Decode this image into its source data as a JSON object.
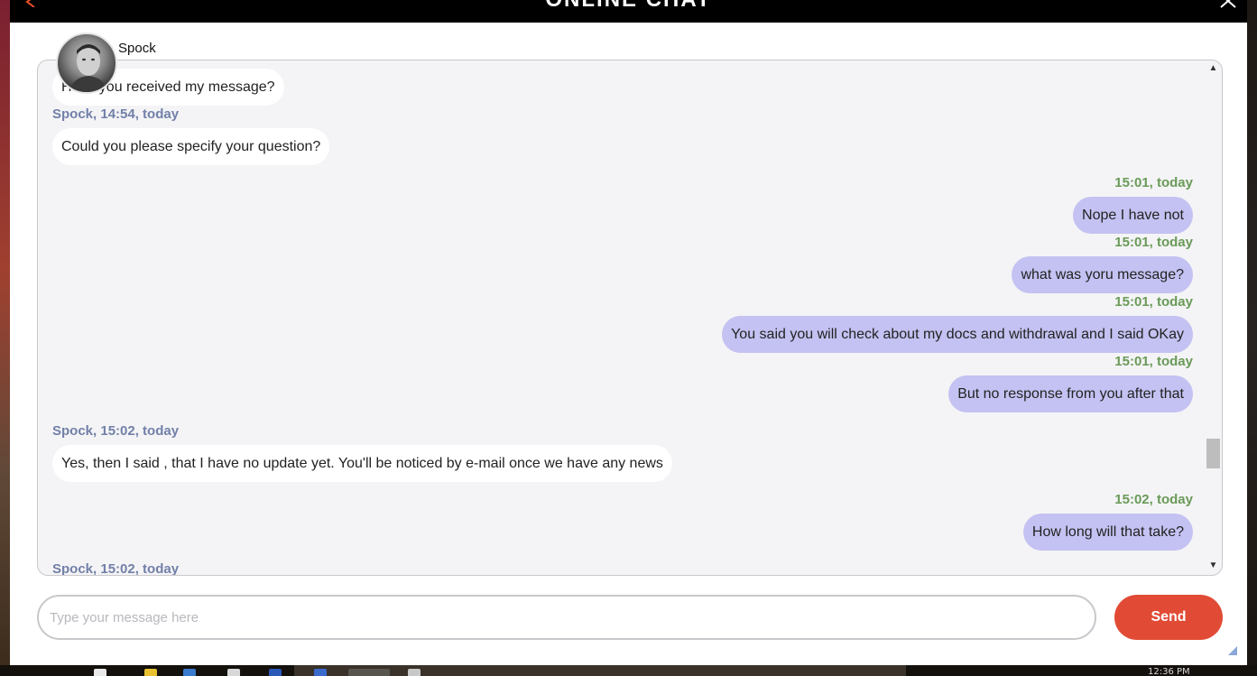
{
  "modal": {
    "title": "ONLINE CHAT",
    "back_icon": "back-triangle-icon",
    "close_icon": "close-icon"
  },
  "agent": {
    "name": "Spock",
    "avatar_icon": "agent-avatar"
  },
  "messages": [
    {
      "from": "agent",
      "text": "Have you received my message?"
    },
    {
      "from": "agent",
      "meta": "Spock, 14:54, today",
      "text": "Could you please specify your question?"
    },
    {
      "from": "user",
      "meta": "15:01, today",
      "text": "Nope I have not"
    },
    {
      "from": "user",
      "meta": "15:01, today",
      "text": "what was yoru message?"
    },
    {
      "from": "user",
      "meta": "15:01, today",
      "text": "You said you will check about my docs and withdrawal and I said OKay"
    },
    {
      "from": "user",
      "meta": "15:01, today",
      "text": "But no response from you after that"
    },
    {
      "from": "agent",
      "meta": "Spock, 15:02, today",
      "text": "Yes, then I said , that I have no update yet. You'll be noticed by e-mail once we have any news"
    },
    {
      "from": "user",
      "meta": "15:02, today",
      "text": "How long will that take?"
    },
    {
      "from": "agent",
      "meta": "Spock, 15:02, today",
      "text": ""
    }
  ],
  "input": {
    "placeholder": "Type your message here",
    "value": ""
  },
  "send_button": {
    "label": "Send"
  },
  "taskbar": {
    "clock": "12:36 PM"
  },
  "colors": {
    "send": "#e14b35",
    "user_bubble": "#c4c2f2",
    "agent_bubble": "#ffffff",
    "agent_meta": "#7280a8",
    "user_meta": "#6a9a58",
    "header": "#000000"
  }
}
